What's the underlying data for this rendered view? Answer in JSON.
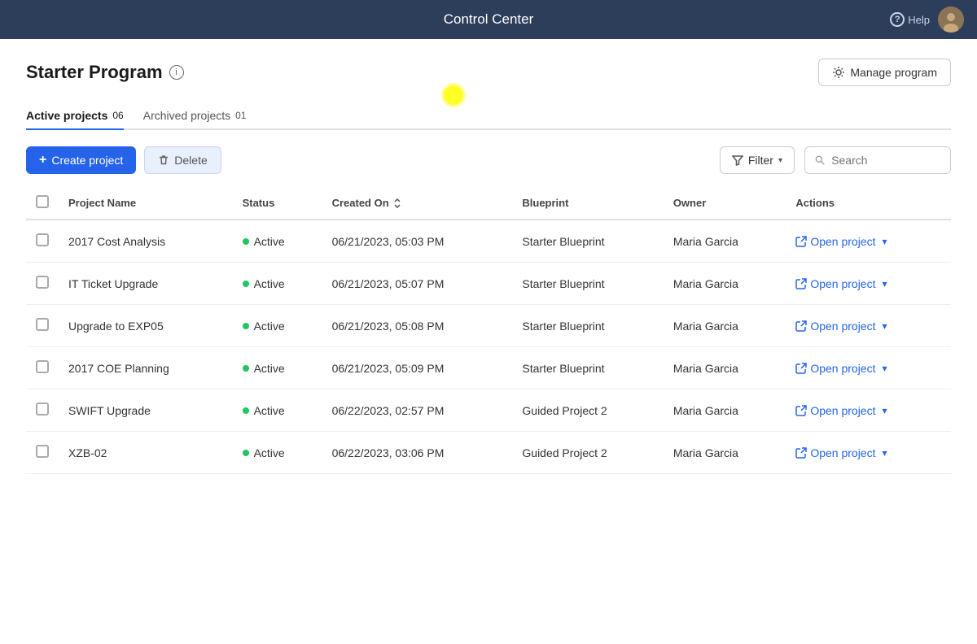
{
  "app": {
    "title": "Control Center",
    "help_label": "Help"
  },
  "page": {
    "title": "Starter Program",
    "info_icon": "ℹ",
    "manage_btn_label": "Manage program"
  },
  "tabs": [
    {
      "label": "Active projects",
      "badge": "06",
      "active": true
    },
    {
      "label": "Archived projects",
      "badge": "01",
      "active": false
    }
  ],
  "toolbar": {
    "create_btn": "Create project",
    "delete_btn": "Delete",
    "filter_btn": "Filter",
    "search_placeholder": "Search"
  },
  "table": {
    "columns": [
      "Project Name",
      "Status",
      "Created On",
      "Blueprint",
      "Owner",
      "Actions"
    ],
    "rows": [
      {
        "name": "2017 Cost Analysis",
        "status": "Active",
        "created_on": "06/21/2023, 05:03 PM",
        "blueprint": "Starter Blueprint",
        "owner": "Maria Garcia",
        "action": "Open project"
      },
      {
        "name": "IT Ticket Upgrade",
        "status": "Active",
        "created_on": "06/21/2023, 05:07 PM",
        "blueprint": "Starter Blueprint",
        "owner": "Maria Garcia",
        "action": "Open project"
      },
      {
        "name": "Upgrade to EXP05",
        "status": "Active",
        "created_on": "06/21/2023, 05:08 PM",
        "blueprint": "Starter Blueprint",
        "owner": "Maria Garcia",
        "action": "Open project"
      },
      {
        "name": "2017 COE Planning",
        "status": "Active",
        "created_on": "06/21/2023, 05:09 PM",
        "blueprint": "Starter Blueprint",
        "owner": "Maria Garcia",
        "action": "Open project"
      },
      {
        "name": "SWIFT Upgrade",
        "status": "Active",
        "created_on": "06/22/2023, 02:57 PM",
        "blueprint": "Guided Project 2",
        "owner": "Maria Garcia",
        "action": "Open project"
      },
      {
        "name": "XZB-02",
        "status": "Active",
        "created_on": "06/22/2023, 03:06 PM",
        "blueprint": "Guided Project 2",
        "owner": "Maria Garcia",
        "action": "Open project"
      }
    ]
  }
}
